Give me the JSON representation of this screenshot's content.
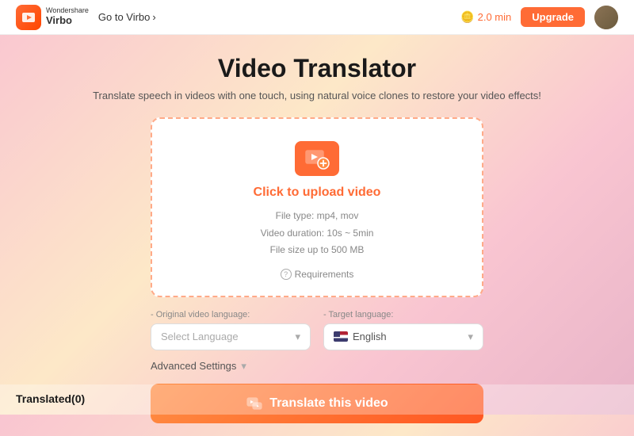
{
  "header": {
    "logo_wonder": "Wondershare",
    "logo_virbo": "Virbo",
    "go_to_virbo": "Go to Virbo",
    "go_chevron": "›",
    "time_label": "2.0 min",
    "upgrade_label": "Upgrade"
  },
  "main": {
    "title": "Video Translator",
    "subtitle": "Translate speech in videos with one touch, using natural voice clones to restore your video effects!",
    "upload": {
      "click_text": "Click to upload video",
      "file_type": "File type: mp4, mov",
      "duration": "Video duration: 10s ~ 5min",
      "file_size": "File size up to 500 MB",
      "requirements": "Requirements"
    },
    "original_lang": {
      "label": "- Original video language:",
      "placeholder": "Select Language"
    },
    "target_lang": {
      "label": "- Target language:",
      "value": "English"
    },
    "advanced_settings": "Advanced Settings",
    "translate_button": "Translate this video"
  },
  "bottom": {
    "translated_label": "Translated(0)"
  },
  "icons": {
    "upload": "upload-video-icon",
    "requirements": "help-circle-icon",
    "chevron_down": "chevron-down-icon",
    "chevron_right": "chevron-right-icon",
    "translate": "translate-icon",
    "coin": "coin-icon"
  }
}
